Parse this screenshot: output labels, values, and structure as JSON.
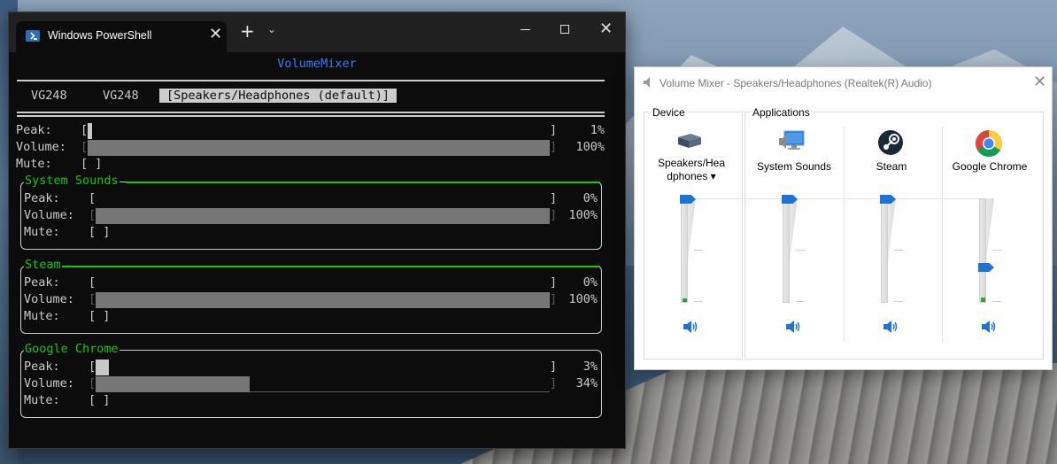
{
  "terminal": {
    "tab_title": "Windows PowerShell",
    "close_glyph": "✕",
    "new_tab_glyph": "+",
    "dropdown_glyph": "⌄",
    "close_window_glyph": "✕",
    "app_title": "VolumeMixer",
    "devices": [
      "VG248",
      "VG248",
      "[Speakers/Headphones (default)]"
    ],
    "master": {
      "peak_label": "Peak:",
      "peak_open": "[",
      "peak_close": "]",
      "peak_value": "1%",
      "peak_level": 0.01,
      "volume_label": "Volume:",
      "volume_open": "[",
      "volume_close": "]",
      "volume_value": "100%",
      "volume_level": 1.0,
      "mute_label": "Mute:",
      "mute_box": "[ ]"
    },
    "groups": [
      {
        "name": "System Sounds",
        "peak_label": "Peak:",
        "peak_open": "[",
        "peak_close": "]",
        "peak_value": "0%",
        "peak_level": 0.0,
        "volume_label": "Volume:",
        "volume_open": "[",
        "volume_close": "]",
        "volume_value": "100%",
        "volume_level": 1.0,
        "mute_label": "Mute:",
        "mute_box": "[ ]"
      },
      {
        "name": "Steam",
        "peak_label": "Peak:",
        "peak_open": "[",
        "peak_close": "]",
        "peak_value": "0%",
        "peak_level": 0.0,
        "volume_label": "Volume:",
        "volume_open": "[",
        "volume_close": "]",
        "volume_value": "100%",
        "volume_level": 1.0,
        "mute_label": "Mute:",
        "mute_box": "[ ]"
      },
      {
        "name": "Google Chrome",
        "peak_label": "Peak:",
        "peak_open": "[",
        "peak_close": "]",
        "peak_value": "3%",
        "peak_level": 0.03,
        "volume_label": "Volume:",
        "volume_open": "[",
        "volume_close": "]",
        "volume_value": "34%",
        "volume_level": 0.34,
        "mute_label": "Mute:",
        "mute_box": "[ ]"
      }
    ]
  },
  "mixer": {
    "title": "Volume Mixer - Speakers/Headphones (Realtek(R) Audio)",
    "close_glyph": "✕",
    "device_legend": "Device",
    "applications_legend": "Applications",
    "device": {
      "label_line1": "Speakers/Hea",
      "label_line2": "dphones",
      "dropdown_glyph": "▾",
      "level": 1.0,
      "peak": 0.01,
      "icon": "speaker-device-icon"
    },
    "apps": [
      {
        "name": "System Sounds",
        "level": 1.0,
        "peak": 0.0,
        "icon": "system-sounds-icon"
      },
      {
        "name": "Steam",
        "level": 1.0,
        "peak": 0.0,
        "icon": "steam-icon"
      },
      {
        "name": "Google Chrome",
        "level": 0.34,
        "peak": 0.03,
        "icon": "chrome-icon"
      }
    ],
    "colors": {
      "accent": "#1e74d6",
      "peak": "#2da43a"
    }
  },
  "colors": {
    "terminal_bg": "#0c0c0c",
    "terminal_text": "#cccccc",
    "title_blue": "#3b78ff",
    "group_green": "#16c60c",
    "bar_gray": "#767676"
  }
}
